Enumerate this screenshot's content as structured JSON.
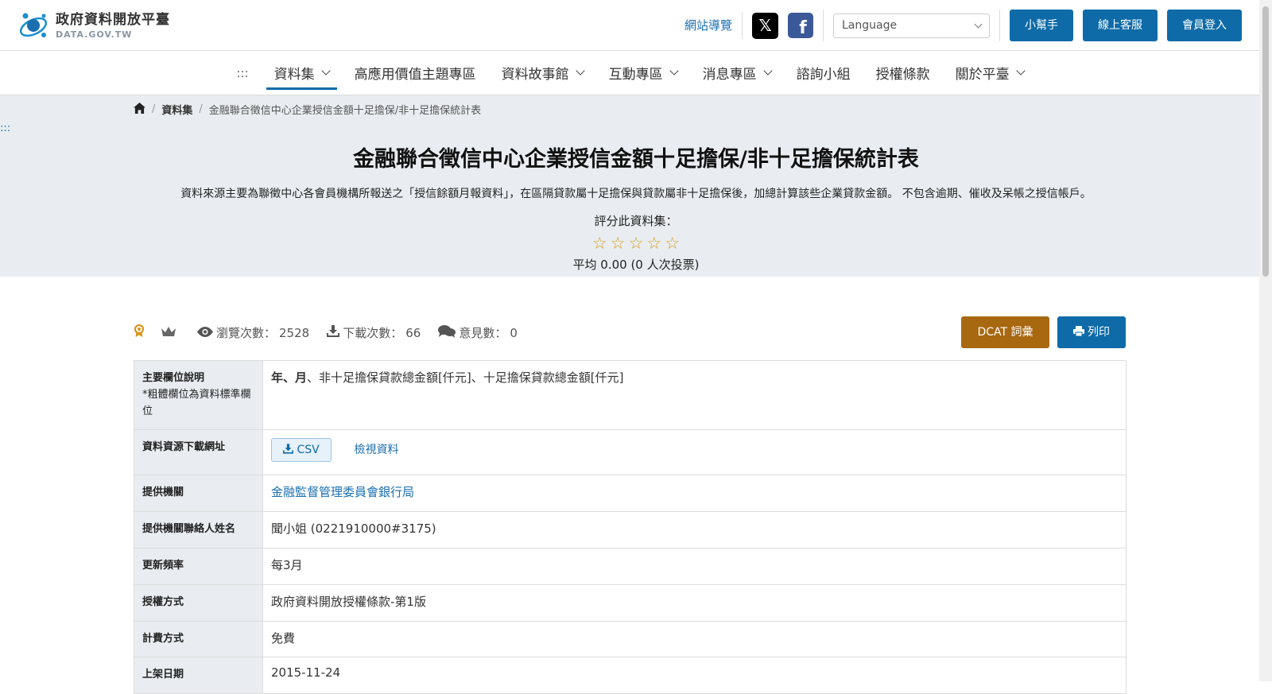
{
  "header": {
    "logo_title": "政府資料開放平臺",
    "logo_subtitle": "DATA.GOV.TW",
    "sitemap": "網站導覽",
    "social": [
      {
        "icon": "x-icon"
      },
      {
        "icon": "facebook-icon"
      }
    ],
    "language_placeholder": "Language",
    "buttons": [
      "小幫手",
      "線上客服",
      "會員登入"
    ],
    "brand_color": "#0e6ba8"
  },
  "nav": {
    "dots": ":::",
    "items": [
      {
        "label": "資料集",
        "dropdown": true,
        "active": true
      },
      {
        "label": "高應用價值主題專區",
        "dropdown": false
      },
      {
        "label": "資料故事館",
        "dropdown": true
      },
      {
        "label": "互動專區",
        "dropdown": true
      },
      {
        "label": "消息專區",
        "dropdown": true
      },
      {
        "label": "諮詢小組",
        "dropdown": false
      },
      {
        "label": "授權條款",
        "dropdown": false
      },
      {
        "label": "關於平臺",
        "dropdown": true
      }
    ]
  },
  "breadcrumb": {
    "home_icon": "home-icon",
    "level1": "資料集",
    "current": "金融聯合徵信中心企業授信金額十足擔保/非十足擔保統計表"
  },
  "side_dots": ":::",
  "dataset": {
    "title": "金融聯合徵信中心企業授信金額十足擔保/非十足擔保統計表",
    "description": "資料來源主要為聯徵中心各會員機構所報送之「授信餘額月報資料」，在區隔貸款屬十足擔保與貸款屬非十足擔保後，加總計算該些企業貸款金額。 不包含逾期、催收及呆帳之授信帳戶。",
    "rating_label": "評分此資料集：",
    "rating_value": 0,
    "rating_max": 5,
    "average": "平均 0.00 (0 人次投票)"
  },
  "stats": {
    "views_label": "瀏覽次數：",
    "views": "2528",
    "downloads_label": "下載次數：",
    "downloads": "66",
    "comments_label": "意見數：",
    "comments": "0",
    "dcat_button": "DCAT 詞彙",
    "print_button": "列印",
    "dcat_color": "#a8680f"
  },
  "info": {
    "fields_label": "主要欄位說明",
    "fields_note": "*粗體欄位為資料標準欄位",
    "fields_bold": "年、月",
    "fields_rest": "、非十足擔保貸款總金額[仟元]、十足擔保貸款總金額[仟元]",
    "download_label": "資料資源下載網址",
    "csv_button": "CSV",
    "view_link": "檢視資料",
    "agency_label": "提供機關",
    "agency": "金融監督管理委員會銀行局",
    "contact_label": "提供機關聯絡人姓名",
    "contact": "聞小姐 (0221910000#3175)",
    "frequency_label": "更新頻率",
    "frequency": "每3月",
    "license_label": "授權方式",
    "license": "政府資料開放授權條款-第1版",
    "fee_label": "計費方式",
    "fee": "免費",
    "listed_label": "上架日期",
    "listed": "2015-11-24"
  }
}
